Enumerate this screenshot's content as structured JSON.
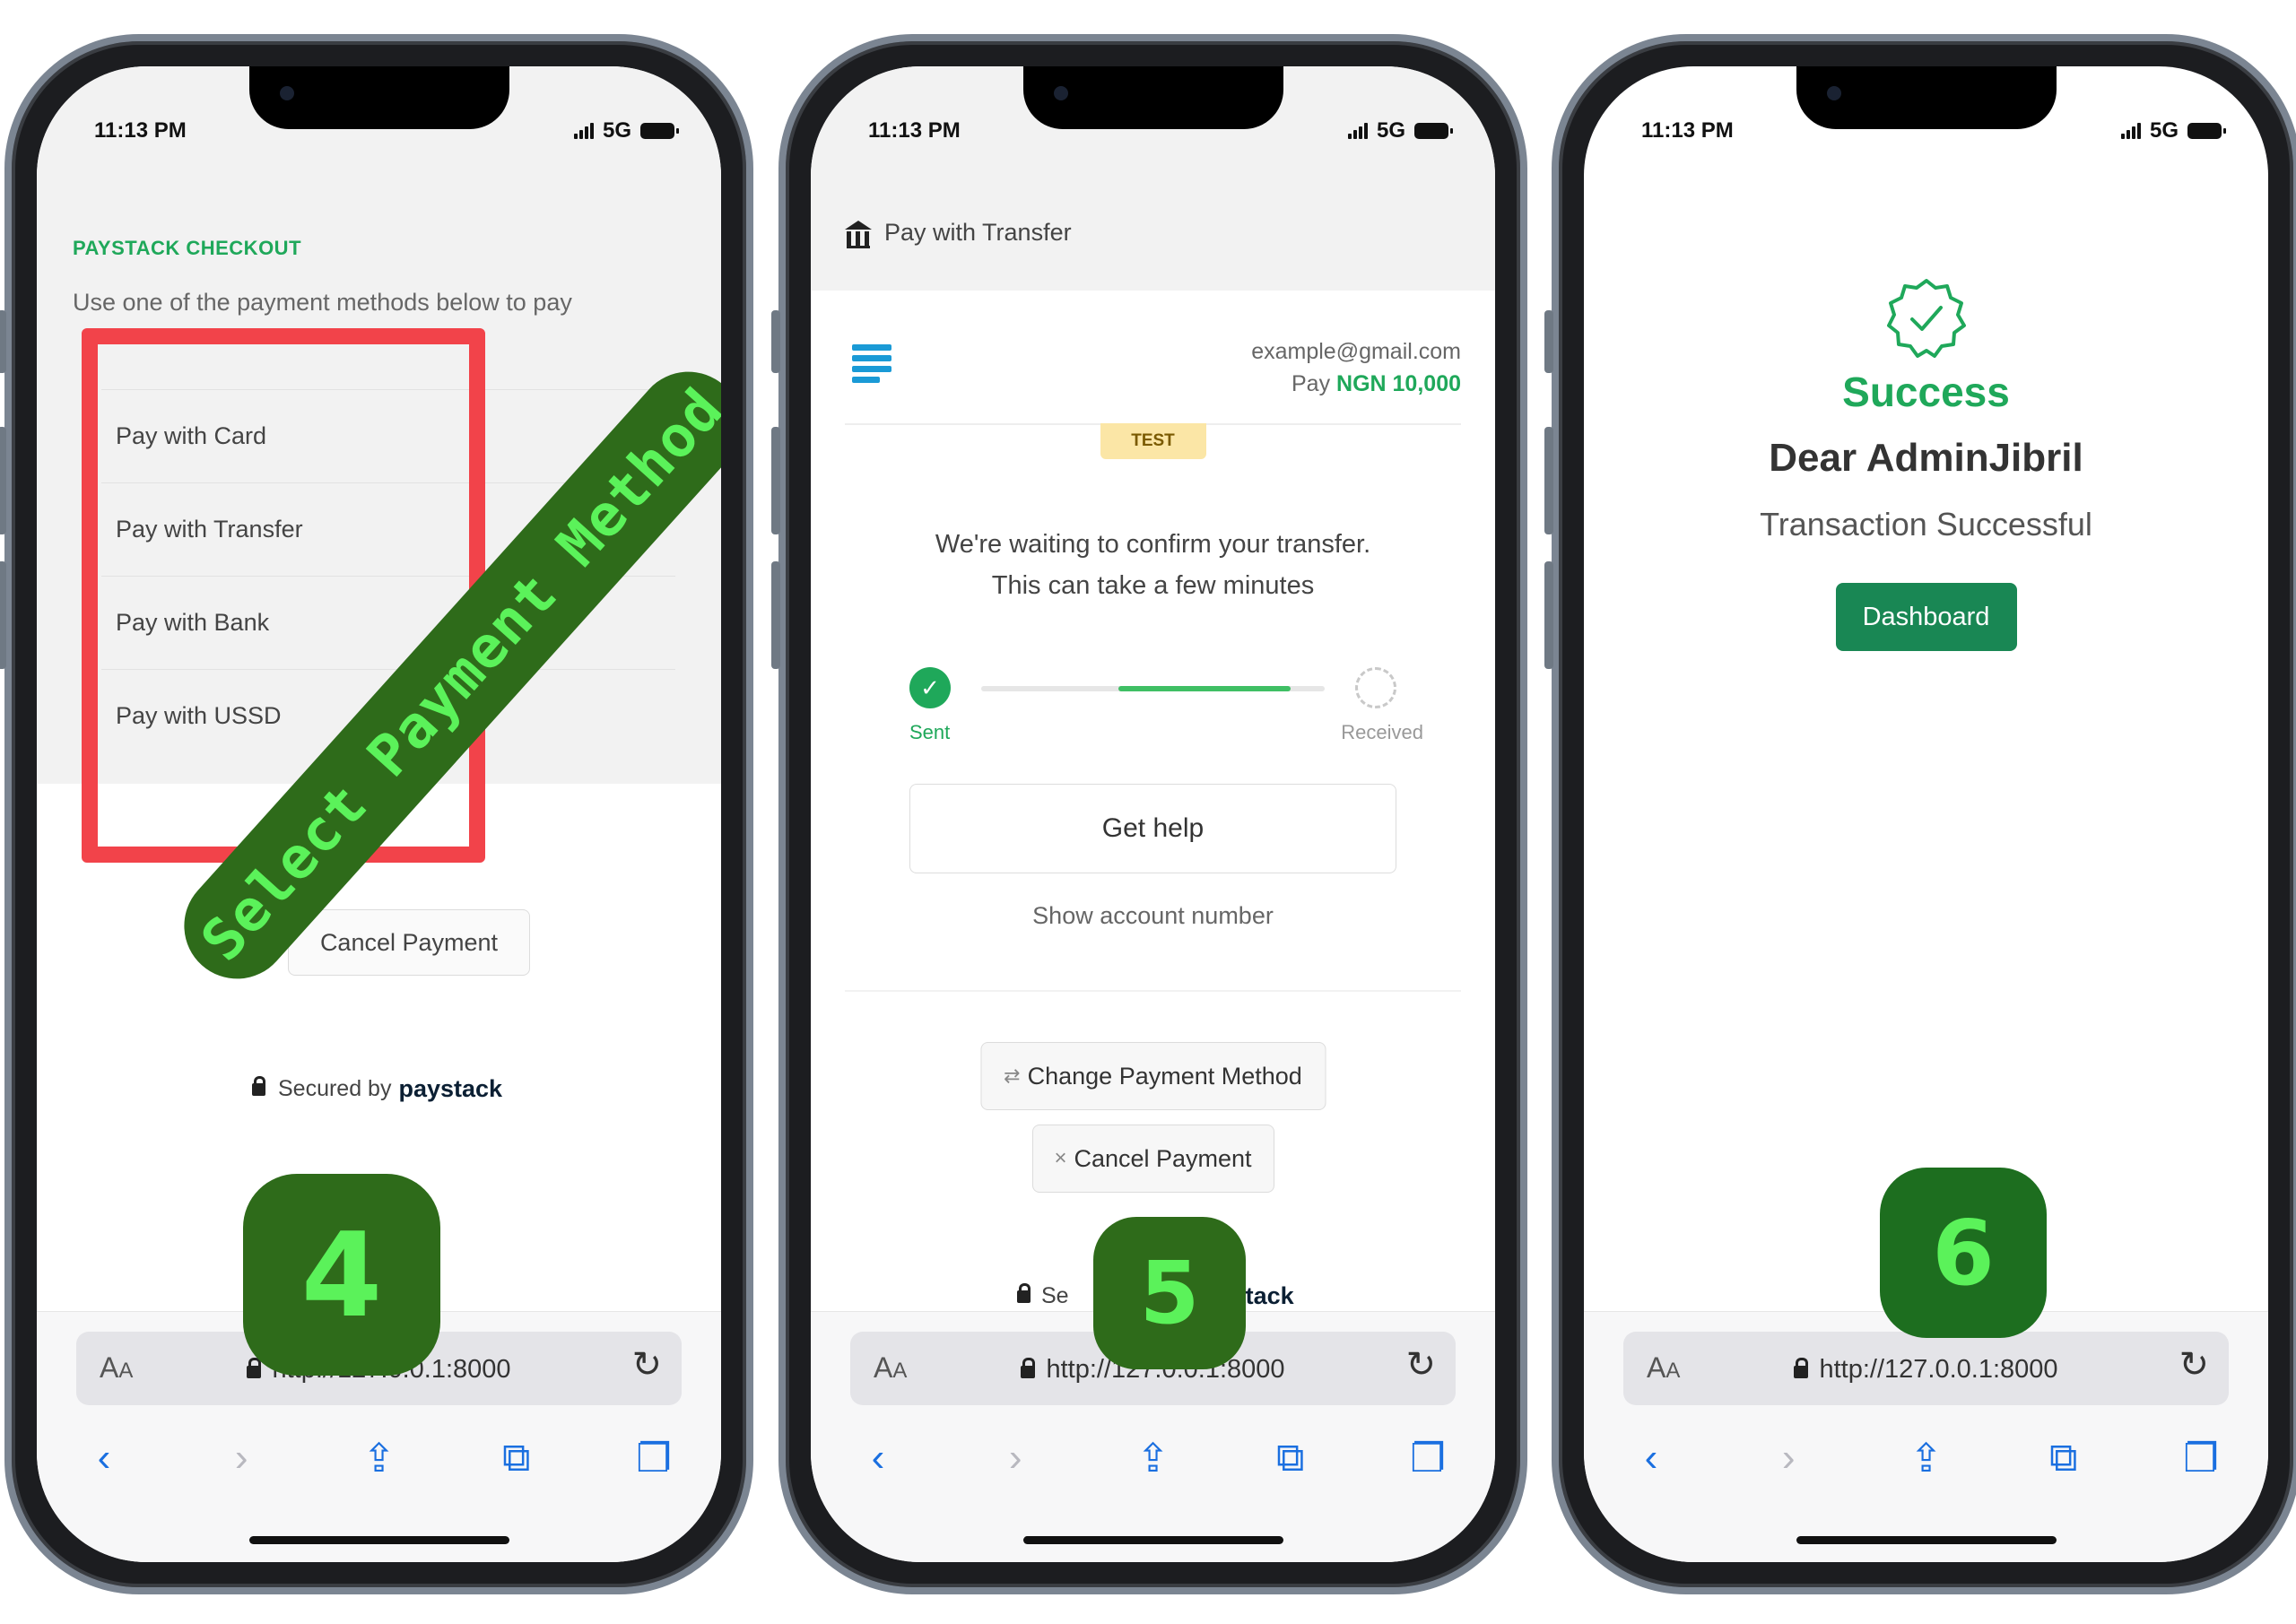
{
  "status_bar": {
    "time": "11:13 PM",
    "network": "5G"
  },
  "browser": {
    "aa_label": "A",
    "aa_small": "A",
    "url": "http://127.0.0.1:8000",
    "reload_icon": "reload-icon",
    "toolbar_icons": [
      "back-icon",
      "forward-icon",
      "share-icon",
      "bookmarks-icon",
      "tabs-icon"
    ]
  },
  "annotations": {
    "ribbon_text": "Select Payment Method",
    "step_4": "4",
    "step_5": "5",
    "step_6": "6",
    "badge_color": "#2e6b1a",
    "badge_text_color": "#5bf25a",
    "highlight_color": "#f2434a"
  },
  "screen4": {
    "heading": "PAYSTACK CHECKOUT",
    "subheading": "Use one of the payment methods below to pay",
    "methods": [
      "Pay with Card",
      "Pay with Transfer",
      "Pay with Bank",
      "Pay with USSD"
    ],
    "cancel_label": "Cancel Payment",
    "secured_by": "Secured by",
    "brand": "paystack"
  },
  "screen5": {
    "title": "Pay with Transfer",
    "email": "example@gmail.com",
    "pay_label": "Pay",
    "amount": "NGN 10,000",
    "test_badge": "TEST",
    "waiting_line1": "We're waiting to confirm your transfer.",
    "waiting_line2": "This can take a few minutes",
    "sent_label": "Sent",
    "received_label": "Received",
    "help_label": "Get help",
    "show_account": "Show account number",
    "change_label": "Change Payment Method",
    "cancel_label": "Cancel Payment",
    "secured_visible_left": "Se",
    "secured_visible_right": "stack"
  },
  "screen6": {
    "status": "Success",
    "greeting": "Dear AdminJibril",
    "message": "Transaction Successful",
    "dashboard_label": "Dashboard"
  },
  "colors": {
    "accent_green": "#1fa85a",
    "dashboard_green": "#198754",
    "url_blue": "#1a6fe0"
  }
}
